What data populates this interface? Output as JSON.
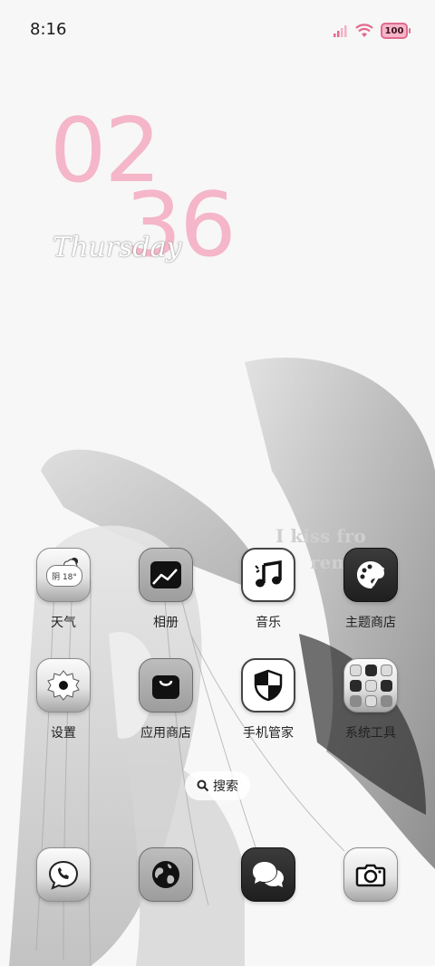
{
  "status_bar": {
    "time": "8:16",
    "battery_level": "100",
    "accent_color": "#e26a8f"
  },
  "clock": {
    "hour": "02",
    "minute": "36",
    "day": "Thursday",
    "color": "#f4b6c8"
  },
  "apps": [
    {
      "label": "天气",
      "icon": "weather-icon",
      "weather_chip": "阴 18°"
    },
    {
      "label": "相册",
      "icon": "gallery-icon"
    },
    {
      "label": "音乐",
      "icon": "music-icon"
    },
    {
      "label": "主题商店",
      "icon": "theme-store-icon"
    },
    {
      "label": "设置",
      "icon": "settings-gear-icon"
    },
    {
      "label": "应用商店",
      "icon": "app-store-bag-icon"
    },
    {
      "label": "手机管家",
      "icon": "security-shield-icon"
    },
    {
      "label": "系统工具",
      "icon": "system-tools-folder-icon"
    }
  ],
  "search": {
    "label": "搜索",
    "icon": "search-icon"
  },
  "dock": [
    {
      "icon": "phone-icon"
    },
    {
      "icon": "browser-globe-icon"
    },
    {
      "icon": "messages-icon"
    },
    {
      "icon": "camera-icon"
    }
  ],
  "wallpaper": {
    "subject": "angel-illustration",
    "watermark": "I kiss fro rem"
  }
}
